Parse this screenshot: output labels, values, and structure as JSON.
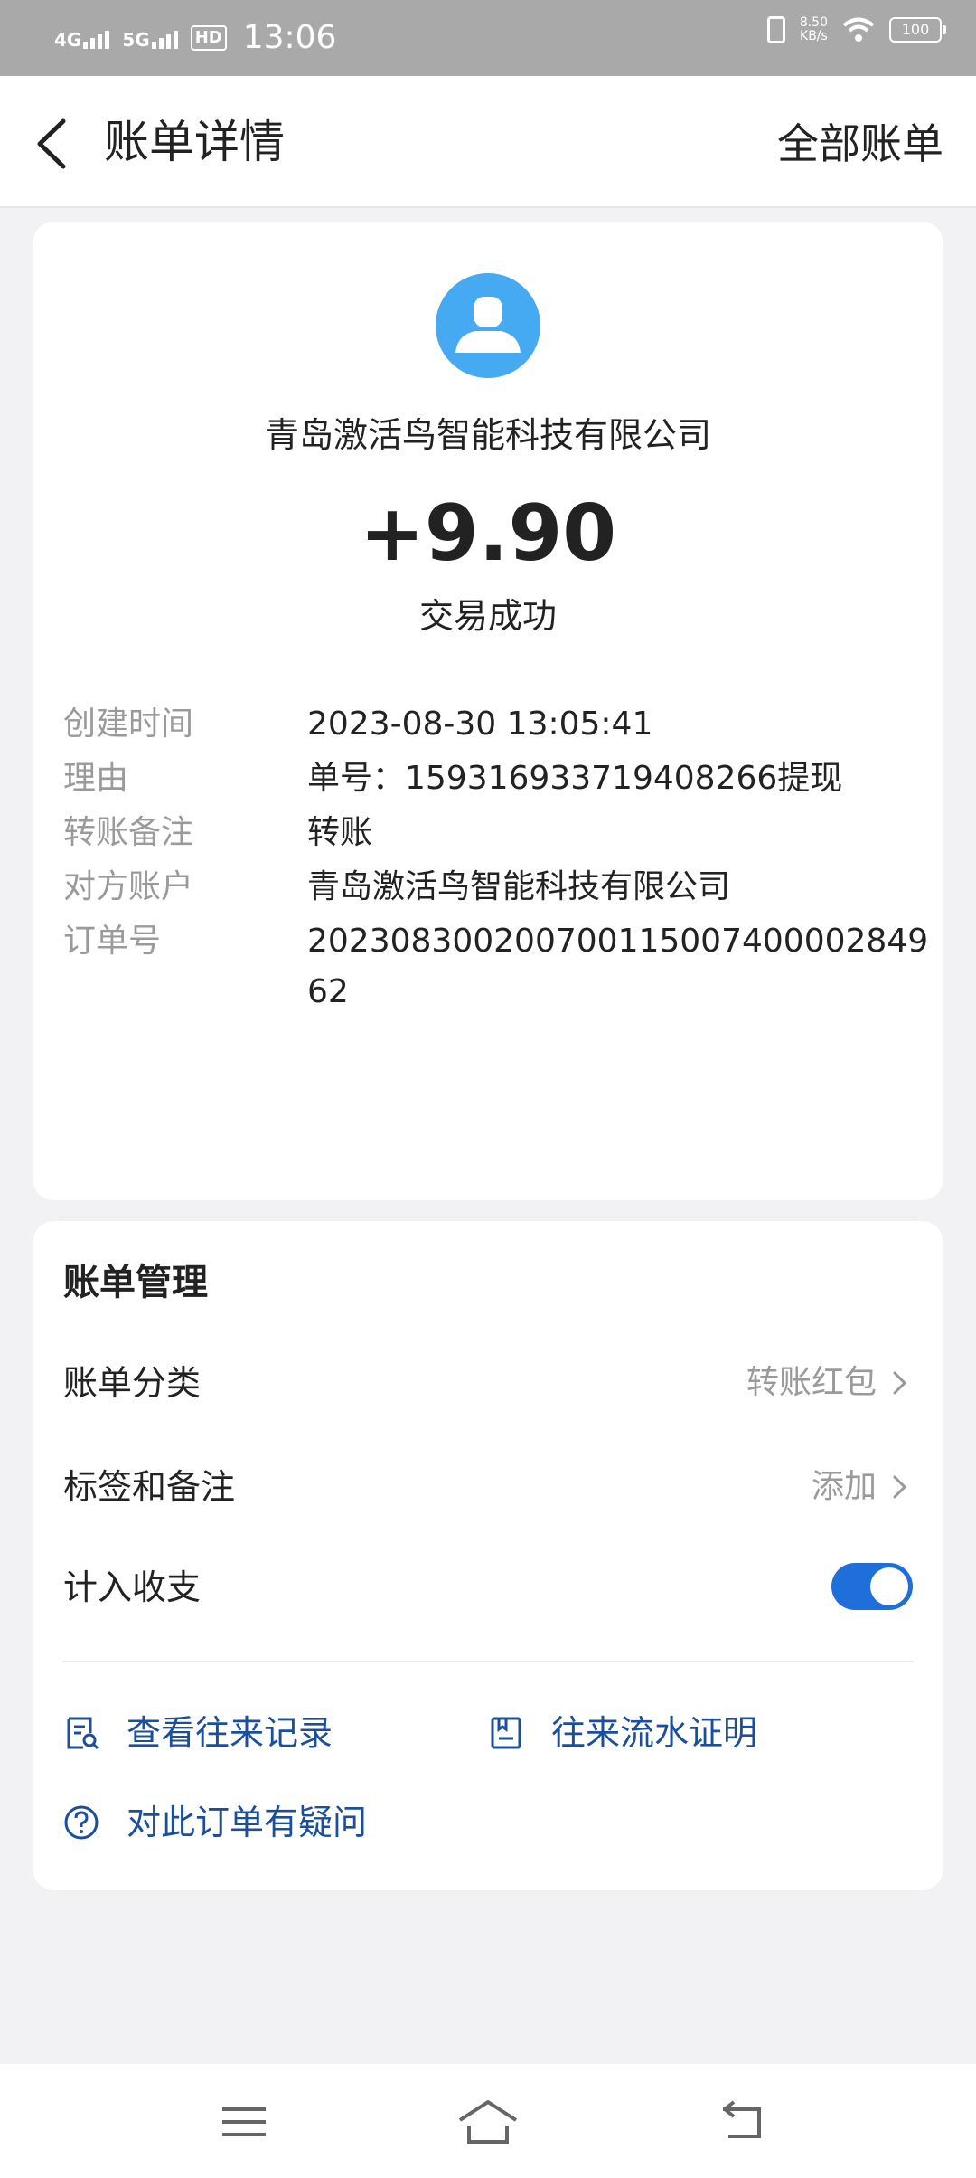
{
  "status_bar": {
    "network1": "4G",
    "network2": "5G",
    "hd": "HD",
    "time": "13:06",
    "speed_value": "8.50",
    "speed_unit": "KB/s",
    "battery": "100"
  },
  "header": {
    "title": "账单详情",
    "all_bills": "全部账单"
  },
  "transaction": {
    "payee": "青岛激活鸟智能科技有限公司",
    "amount": "+9.90",
    "status": "交易成功",
    "details": [
      {
        "key": "创建时间",
        "value": "2023-08-30 13:05:41"
      },
      {
        "key": "理由",
        "value": "单号：15931693371940826​6提现"
      },
      {
        "key": "转账备注",
        "value": "转账"
      },
      {
        "key": "对方账户",
        "value": "青岛激活鸟智能科技有限公司"
      },
      {
        "key": "订单号",
        "value": "2023083002007001150074000028​4962"
      }
    ]
  },
  "management": {
    "title": "账单管理",
    "category_label": "账单分类",
    "category_value": "转账红包",
    "tags_label": "标签和备注",
    "tags_value": "添加",
    "include_label": "计入收支",
    "include_on": true,
    "link_records": "查看往来记录",
    "link_proof": "往来流水证明",
    "link_question": "对此订单有疑问"
  },
  "colors": {
    "accent": "#1e6fd9",
    "link": "#1b4f9c",
    "avatar": "#45aaf2"
  },
  "icons": [
    "back-arrow-icon",
    "avatar-person-icon",
    "chevron-right-icon",
    "record-search-icon",
    "document-icon",
    "question-circle-icon",
    "menu-icon",
    "home-icon",
    "return-icon"
  ]
}
